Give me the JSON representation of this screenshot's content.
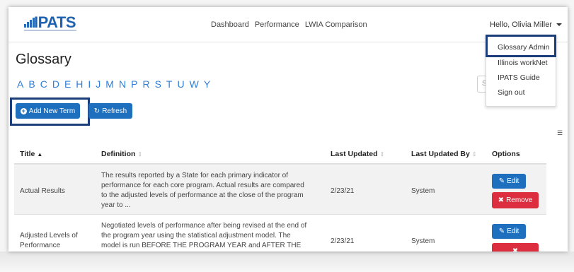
{
  "header": {
    "logo_text": "IPATS",
    "nav": [
      "Dashboard",
      "Performance",
      "LWIA Comparison"
    ],
    "user_greeting": "Hello, Olivia Miller"
  },
  "user_menu": {
    "items": [
      "Glossary Admin",
      "Illinois workNet",
      "IPATS Guide",
      "Sign out"
    ]
  },
  "page": {
    "title": "Glossary",
    "letters": [
      "A",
      "B",
      "C",
      "D",
      "E",
      "H",
      "I",
      "J",
      "M",
      "N",
      "P",
      "R",
      "S",
      "T",
      "U",
      "W",
      "Y"
    ],
    "search_placeholder": "S"
  },
  "toolbar": {
    "add_label": "Add New Term",
    "refresh_label": "Refresh"
  },
  "table": {
    "headers": [
      "Title",
      "Definition",
      "Last Updated",
      "Last Updated By",
      "Options"
    ],
    "rows": [
      {
        "title": "Actual Results",
        "definition_lines": [
          "The results reported by a State for each primary indicator of",
          "performance for each core program. Actual results are compared",
          "to the adjusted levels of performance at the close of the program",
          "year to ..."
        ],
        "updated": "2/23/21",
        "updated_by": "System",
        "edit_label": "Edit",
        "remove_label": "Remove"
      },
      {
        "title_lines": [
          "Adjusted Levels of",
          "Performance"
        ],
        "definition_lines": [
          "Negotiated levels of performance after being revised at the end of",
          "the program year using the statistical adjustment model. The",
          "model is run BEFORE THE PROGRAM YEAR and AFTER THE CLOSE"
        ],
        "updated": "2/23/21",
        "updated_by": "System",
        "edit_label": "Edit"
      }
    ]
  },
  "colors": {
    "primary": "#1f6fbf",
    "danger": "#dc2e3f",
    "link": "#2f7fd6",
    "highlight_border": "#1b3d7a"
  }
}
